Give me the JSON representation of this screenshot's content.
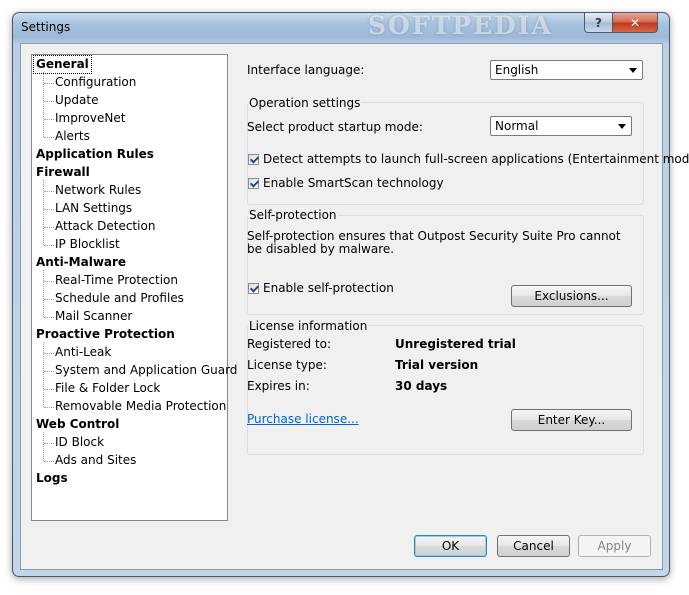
{
  "window": {
    "title": "Settings",
    "watermark": "SOFTPEDIA",
    "help_label": "?",
    "close_label": "✕"
  },
  "tree": {
    "items": [
      {
        "label": "General",
        "level": 0,
        "selected": true
      },
      {
        "label": "Configuration",
        "level": 1
      },
      {
        "label": "Update",
        "level": 1
      },
      {
        "label": "ImproveNet",
        "level": 1
      },
      {
        "label": "Alerts",
        "level": 1
      },
      {
        "label": "Application Rules",
        "level": 0
      },
      {
        "label": "Firewall",
        "level": 0
      },
      {
        "label": "Network Rules",
        "level": 1
      },
      {
        "label": "LAN Settings",
        "level": 1
      },
      {
        "label": "Attack Detection",
        "level": 1
      },
      {
        "label": "IP Blocklist",
        "level": 1
      },
      {
        "label": "Anti-Malware",
        "level": 0
      },
      {
        "label": "Real-Time Protection",
        "level": 1
      },
      {
        "label": "Schedule and Profiles",
        "level": 1
      },
      {
        "label": "Mail Scanner",
        "level": 1
      },
      {
        "label": "Proactive Protection",
        "level": 0
      },
      {
        "label": "Anti-Leak",
        "level": 1
      },
      {
        "label": "System and Application Guard",
        "level": 1
      },
      {
        "label": "File & Folder Lock",
        "level": 1
      },
      {
        "label": "Removable Media Protection",
        "level": 1
      },
      {
        "label": "Web Control",
        "level": 0
      },
      {
        "label": "ID Block",
        "level": 1
      },
      {
        "label": "Ads and Sites",
        "level": 1
      },
      {
        "label": "Logs",
        "level": 0
      }
    ]
  },
  "general": {
    "language_label": "Interface language:",
    "language_value": "English",
    "operation": {
      "title": "Operation settings",
      "startup_label": "Select product startup mode:",
      "startup_value": "Normal",
      "detect_fullscreen": "Detect attempts to launch full-screen applications (Entertainment mode)",
      "smartscan": "Enable SmartScan technology"
    },
    "self_protection": {
      "title": "Self-protection",
      "description": "Self-protection ensures that Outpost Security Suite Pro cannot be disabled by malware.",
      "enable_label": "Enable self-protection",
      "exclusions_button": "Exclusions..."
    },
    "license": {
      "title": "License information",
      "registered_label": "Registered to:",
      "registered_value": "Unregistered trial",
      "type_label": "License type:",
      "type_value": "Trial version",
      "expires_label": "Expires in:",
      "expires_value": "30 days",
      "purchase_link": "Purchase license...",
      "enter_key_button": "Enter Key..."
    }
  },
  "footer": {
    "ok": "OK",
    "cancel": "Cancel",
    "apply": "Apply"
  }
}
